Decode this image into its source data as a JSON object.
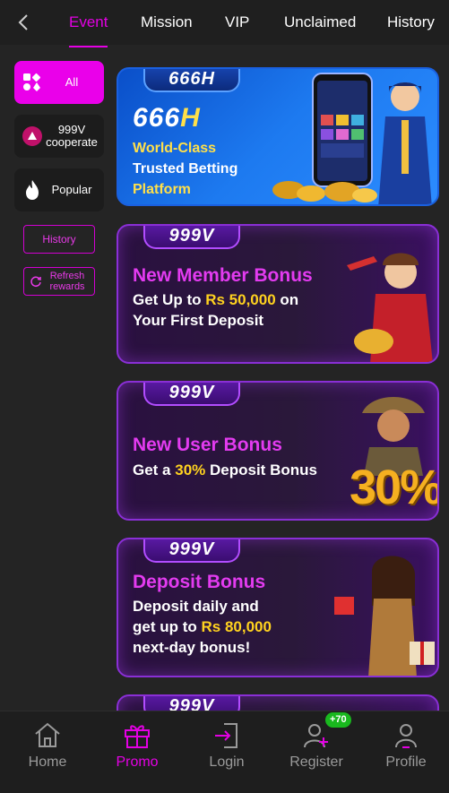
{
  "header": {
    "tabs": [
      {
        "label": "Event",
        "active": true
      },
      {
        "label": "Mission"
      },
      {
        "label": "VIP"
      },
      {
        "label": "Unclaimed"
      },
      {
        "label": "History"
      }
    ]
  },
  "sidebar": {
    "categories": [
      {
        "label": "All",
        "icon": "grid-suits-icon",
        "active": true
      },
      {
        "label": "999V cooperate",
        "icon": "999v-logo-icon"
      },
      {
        "label": "Popular",
        "icon": "flame-icon"
      }
    ],
    "history_label": "History",
    "refresh_label": "Refresh rewards"
  },
  "banners": [
    {
      "brand": "666H",
      "brand_main": "666",
      "brand_h": "H",
      "lines": [
        "World-Class",
        "Trusted Betting",
        "Platform"
      ]
    },
    {
      "brand": "999V",
      "title": "New Member Bonus",
      "line1": "Get Up to ",
      "line1_hl": "Rs 50,000",
      "line1_end": " on",
      "line2": "Your First Deposit"
    },
    {
      "brand": "999V",
      "title": "New User Bonus",
      "line1": "Get a ",
      "line1_hl": "30%",
      "line1_end": " Deposit Bonus",
      "big_percent": "30%"
    },
    {
      "brand": "999V",
      "title": "Deposit Bonus",
      "line1": "Deposit daily and",
      "line2": "get up to ",
      "line2_hl": "Rs 80,000",
      "line3": "next-day bonus!"
    },
    {
      "brand": "999V"
    }
  ],
  "bottom_nav": [
    {
      "label": "Home",
      "icon": "home-icon"
    },
    {
      "label": "Promo",
      "icon": "gift-icon",
      "active": true
    },
    {
      "label": "Login",
      "icon": "login-icon"
    },
    {
      "label": "Register",
      "icon": "register-icon",
      "badge": "+70"
    },
    {
      "label": "Profile",
      "icon": "profile-icon"
    }
  ],
  "colors": {
    "accent": "#e400e4",
    "background": "#242424",
    "highlight": "#ffd21f",
    "badge": "#19b81e"
  }
}
